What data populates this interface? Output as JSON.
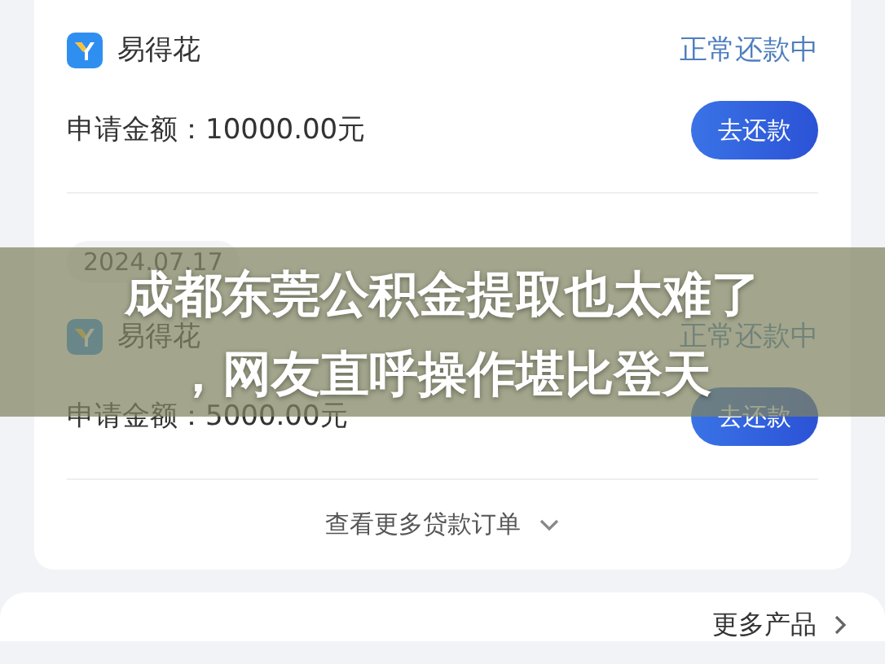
{
  "orders": [
    {
      "app": "易得花",
      "status": "正常还款中",
      "amount": "申请金额：10000.00元",
      "button": "去还款"
    },
    {
      "date": "2024.07.17",
      "app": "易得花",
      "status": "正常还款中",
      "amount": "申请金额：5000.00元",
      "button": "去还款"
    }
  ],
  "more_orders": "查看更多贷款订单",
  "more_products": "更多产品",
  "headline": [
    "成都东莞公积金提取也太难了",
    "，网友直呼操作堪比登天"
  ]
}
